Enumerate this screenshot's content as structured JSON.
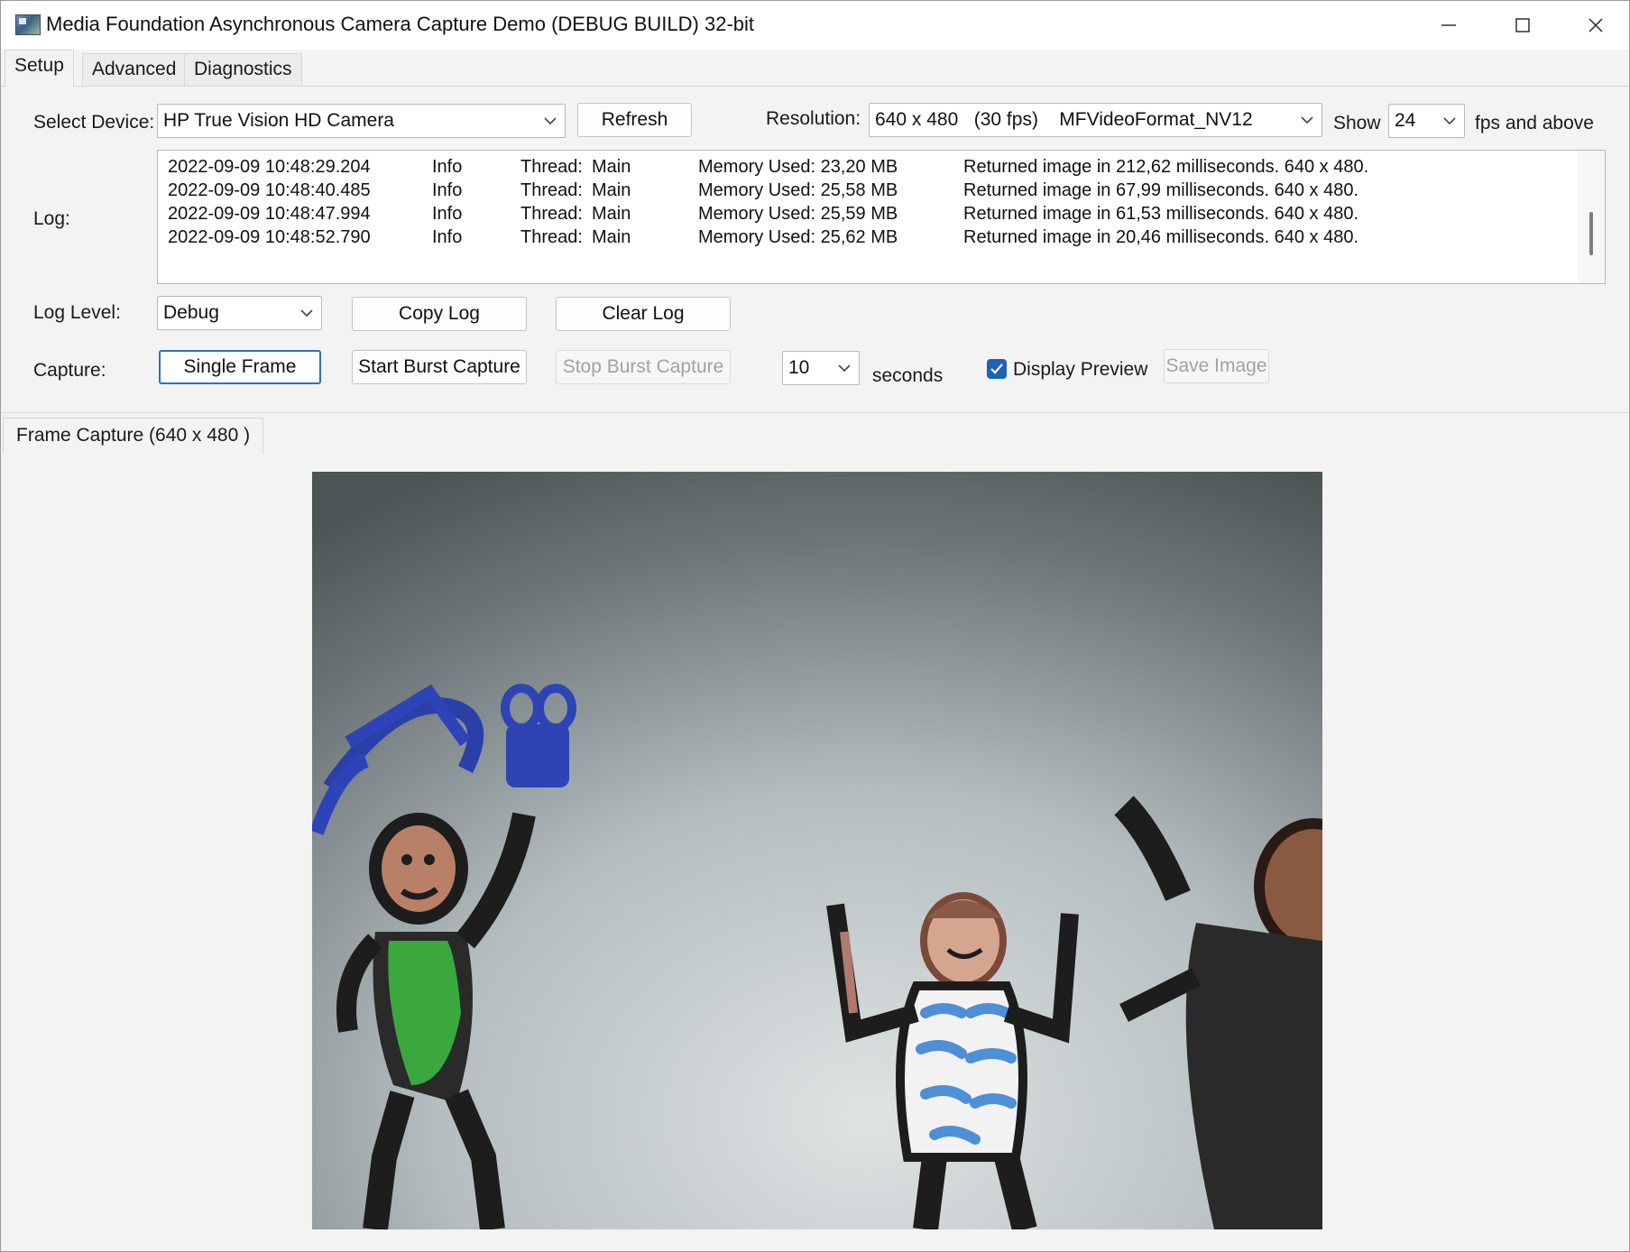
{
  "window": {
    "title": "Media Foundation Asynchronous Camera Capture Demo (DEBUG BUILD) 32-bit"
  },
  "tabs": [
    {
      "label": "Setup",
      "active": true
    },
    {
      "label": "Advanced",
      "active": false
    },
    {
      "label": "Diagnostics",
      "active": false
    }
  ],
  "device": {
    "label": "Select Device:",
    "value": "HP True Vision HD Camera",
    "refresh_label": "Refresh"
  },
  "resolution": {
    "label": "Resolution:",
    "value": "640 x 480   (30 fps)    MFVideoFormat_NV12",
    "show_label": "Show",
    "fps_value": "24",
    "fps_suffix": "fps and above"
  },
  "log": {
    "label": "Log:",
    "rows": [
      {
        "time": "2022-09-09 10:48:29.204",
        "level": "Info",
        "thread_label": "Thread:",
        "thread": "Main",
        "memory": "Memory Used: 23,20 MB",
        "message": "Returned image in 212,62 milliseconds. 640 x 480."
      },
      {
        "time": "2022-09-09 10:48:40.485",
        "level": "Info",
        "thread_label": "Thread:",
        "thread": "Main",
        "memory": "Memory Used: 25,58 MB",
        "message": "Returned image in 67,99 milliseconds. 640 x 480."
      },
      {
        "time": "2022-09-09 10:48:47.994",
        "level": "Info",
        "thread_label": "Thread:",
        "thread": "Main",
        "memory": "Memory Used: 25,59 MB",
        "message": "Returned image in 61,53 milliseconds. 640 x 480."
      },
      {
        "time": "2022-09-09 10:48:52.790",
        "level": "Info",
        "thread_label": "Thread:",
        "thread": "Main",
        "memory": "Memory Used: 25,62 MB",
        "message": "Returned image in 20,46 milliseconds. 640 x 480."
      }
    ]
  },
  "log_level": {
    "label": "Log Level:",
    "value": "Debug",
    "copy_label": "Copy Log",
    "clear_label": "Clear Log"
  },
  "capture": {
    "label": "Capture:",
    "single_frame_label": "Single Frame",
    "start_burst_label": "Start Burst Capture",
    "stop_burst_label": "Stop Burst Capture",
    "seconds_value": "10",
    "seconds_label": "seconds",
    "display_preview_label": "Display Preview",
    "display_preview_checked": true,
    "save_image_label": "Save Image"
  },
  "frame_capture": {
    "tab_label": "Frame Capture (640 x 480 )"
  },
  "colors": {
    "accent": "#1e62b8",
    "window_bg": "#f3f3f3"
  },
  "icons": [
    "app-icon",
    "minimize-icon",
    "maximize-icon",
    "close-icon",
    "chevron-down-icon",
    "checkmark-icon"
  ]
}
